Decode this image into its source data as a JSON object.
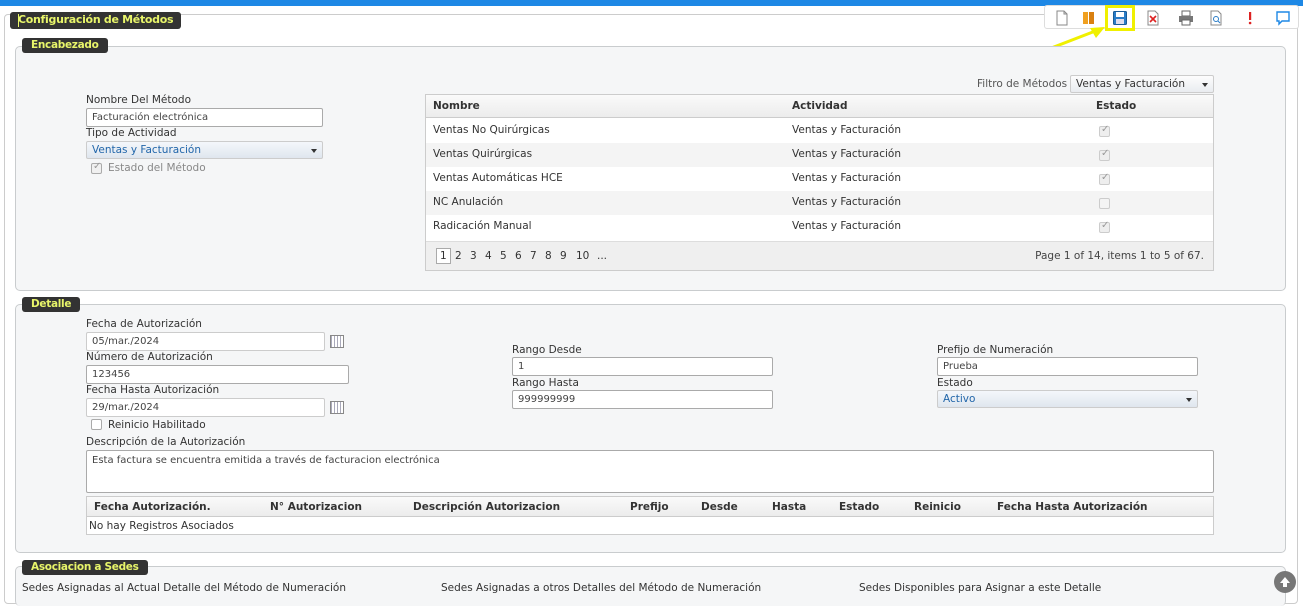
{
  "app_title": "Configuración de Métodos",
  "toolbar": {
    "icons": [
      "new-document-icon",
      "book-icon",
      "save-icon",
      "cancel-icon",
      "print-icon",
      "preview-icon",
      "help-icon",
      "chat-icon"
    ]
  },
  "encabezado": {
    "title": "Encabezado",
    "nombre_label": "Nombre Del Método",
    "nombre_value": "Facturación electrónica",
    "tipo_label": "Tipo de Actividad",
    "tipo_value": "Ventas y Facturación",
    "estado_label": "Estado del Método",
    "filtro_label": "Filtro de Métodos",
    "filtro_value": "Ventas y Facturación",
    "grid": {
      "headers": [
        "Nombre",
        "Actividad",
        "Estado"
      ],
      "rows": [
        {
          "nombre": "Ventas No Quirúrgicas",
          "actividad": "Ventas y Facturación",
          "checked": true
        },
        {
          "nombre": "Ventas Quirúrgicas",
          "actividad": "Ventas y Facturación",
          "checked": true
        },
        {
          "nombre": "Ventas Automáticas HCE",
          "actividad": "Ventas y Facturación",
          "checked": true
        },
        {
          "nombre": "NC Anulación",
          "actividad": "Ventas y Facturación",
          "checked": false
        },
        {
          "nombre": "Radicación Manual",
          "actividad": "Ventas y Facturación",
          "checked": true
        }
      ],
      "pages": [
        "1",
        "2",
        "3",
        "4",
        "5",
        "6",
        "7",
        "8",
        "9",
        "10",
        "..."
      ],
      "page_info": "Page 1 of 14, items 1 to 5 of 67."
    }
  },
  "detalle": {
    "title": "Detalle",
    "fecha_aut_label": "Fecha de Autorización",
    "fecha_aut_value": "05/mar./2024",
    "num_aut_label": "Número de Autorización",
    "num_aut_value": "123456",
    "fecha_hasta_label": "Fecha Hasta Autorización",
    "fecha_hasta_value": "29/mar./2024",
    "reinicio_label": "Reinicio Habilitado",
    "rango_desde_label": "Rango Desde",
    "rango_desde_value": "1",
    "rango_hasta_label": "Rango Hasta",
    "rango_hasta_value": "999999999",
    "prefijo_label": "Prefijo de Numeración",
    "prefijo_value": "Prueba",
    "estado_label": "Estado",
    "estado_value": "Activo",
    "descripcion_label": "Descripción de la Autorización",
    "descripcion_value": "Esta factura se encuentra emitida a través de facturacion electrónica",
    "table_headers": [
      "Fecha Autorización.",
      "N° Autorizacion",
      "Descripción Autorizacion",
      "Prefijo",
      "Desde",
      "Hasta",
      "Estado",
      "Reinicio",
      "Fecha Hasta Autorización"
    ],
    "empty_text": "No hay Registros Asociados"
  },
  "sedes": {
    "title": "Asociacion a Sedes",
    "col1": "Sedes Asignadas al Actual Detalle del Método de Numeración",
    "col2": "Sedes Asignadas a otros Detalles del Método de Numeración",
    "col3": "Sedes Disponibles para Asignar a este Detalle"
  },
  "colors": {
    "accent_bar": "#1e88e5",
    "title_bg": "#333333",
    "title_fg": "#e8f56a",
    "highlight": "#f0f000"
  }
}
